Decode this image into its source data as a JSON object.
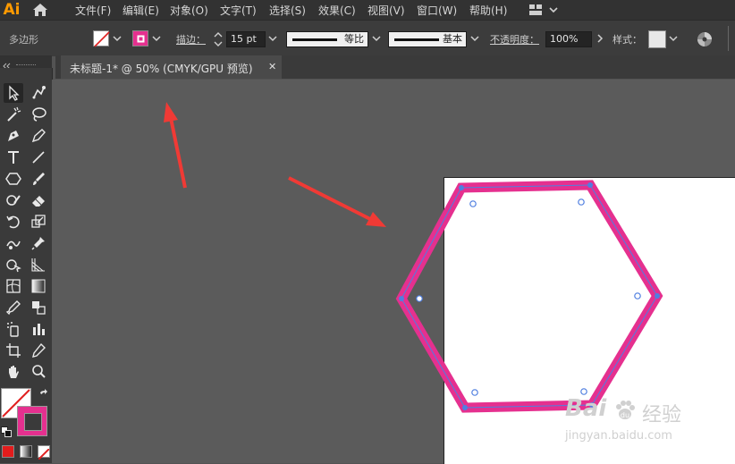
{
  "app": {
    "logo": "Ai"
  },
  "menu": {
    "items": [
      "文件(F)",
      "编辑(E)",
      "对象(O)",
      "文字(T)",
      "选择(S)",
      "效果(C)",
      "视图(V)",
      "窗口(W)",
      "帮助(H)"
    ]
  },
  "control_bar": {
    "tool_name": "多边形",
    "stroke_label": "描边：",
    "stroke_weight": "15 pt",
    "profile_label": "等比",
    "brush_label": "基本",
    "opacity_label": "不透明度：",
    "opacity_value": "100%",
    "style_label": "样式：",
    "stroke_color": "#e5308f"
  },
  "document": {
    "tab_title": "未标题-1* @ 50% (CMYK/GPU 预览)",
    "close_glyph": "✕"
  },
  "tools": {
    "fill_color": "#ffffff",
    "stroke_color": "#e5308f"
  },
  "watermark": {
    "brand": "Bai",
    "brand_suffix": "经验",
    "url": "jingyan.baidu.com"
  },
  "annotations": {
    "arrow_color": "#f03a35"
  }
}
